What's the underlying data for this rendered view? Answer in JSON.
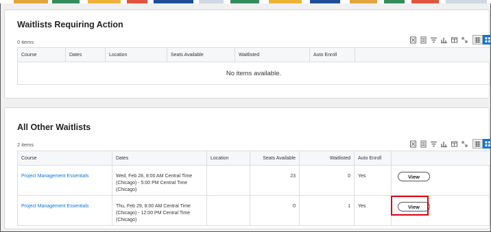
{
  "section1": {
    "title": "Waitlists Requiring Action",
    "count": "0 items",
    "columns": [
      "Course",
      "Dates",
      "Location",
      "Seats Available",
      "Waitlisted",
      "Auto Enroll"
    ],
    "empty_message": "No items available."
  },
  "section2": {
    "title": "All Other Waitlists",
    "count": "2 items",
    "columns": [
      "Course",
      "Dates",
      "Location",
      "Seats Available",
      "Waitlisted",
      "Auto Enroll"
    ],
    "rows": [
      {
        "course": "Project Management Essentials",
        "dates": [
          "Wed, Feb 28, 8:00 AM Central Time",
          "(Chicago)  -  5:00 PM Central Time",
          "(Chicago)"
        ],
        "location": "",
        "seats_available": "23",
        "waitlisted": "0",
        "auto_enroll": "Yes",
        "action": "View"
      },
      {
        "course": "Project Management Essentials",
        "dates": [
          "Thu, Feb 29, 8:00 AM Central Time",
          "(Chicago)  -  12:00 PM Central Time",
          "(Chicago)"
        ],
        "location": "",
        "seats_available": "0",
        "waitlisted": "1",
        "auto_enroll": "Yes",
        "action": "View"
      }
    ]
  },
  "toolbar": {
    "icons": [
      "excel-export-icon",
      "pdf-export-icon",
      "filter-icon",
      "chart-icon",
      "columns-icon",
      "fullscreen-icon",
      "table-view-icon",
      "grid-view-icon"
    ]
  },
  "colors": {
    "accent": "#0875e1",
    "highlight": "#dd0000"
  }
}
